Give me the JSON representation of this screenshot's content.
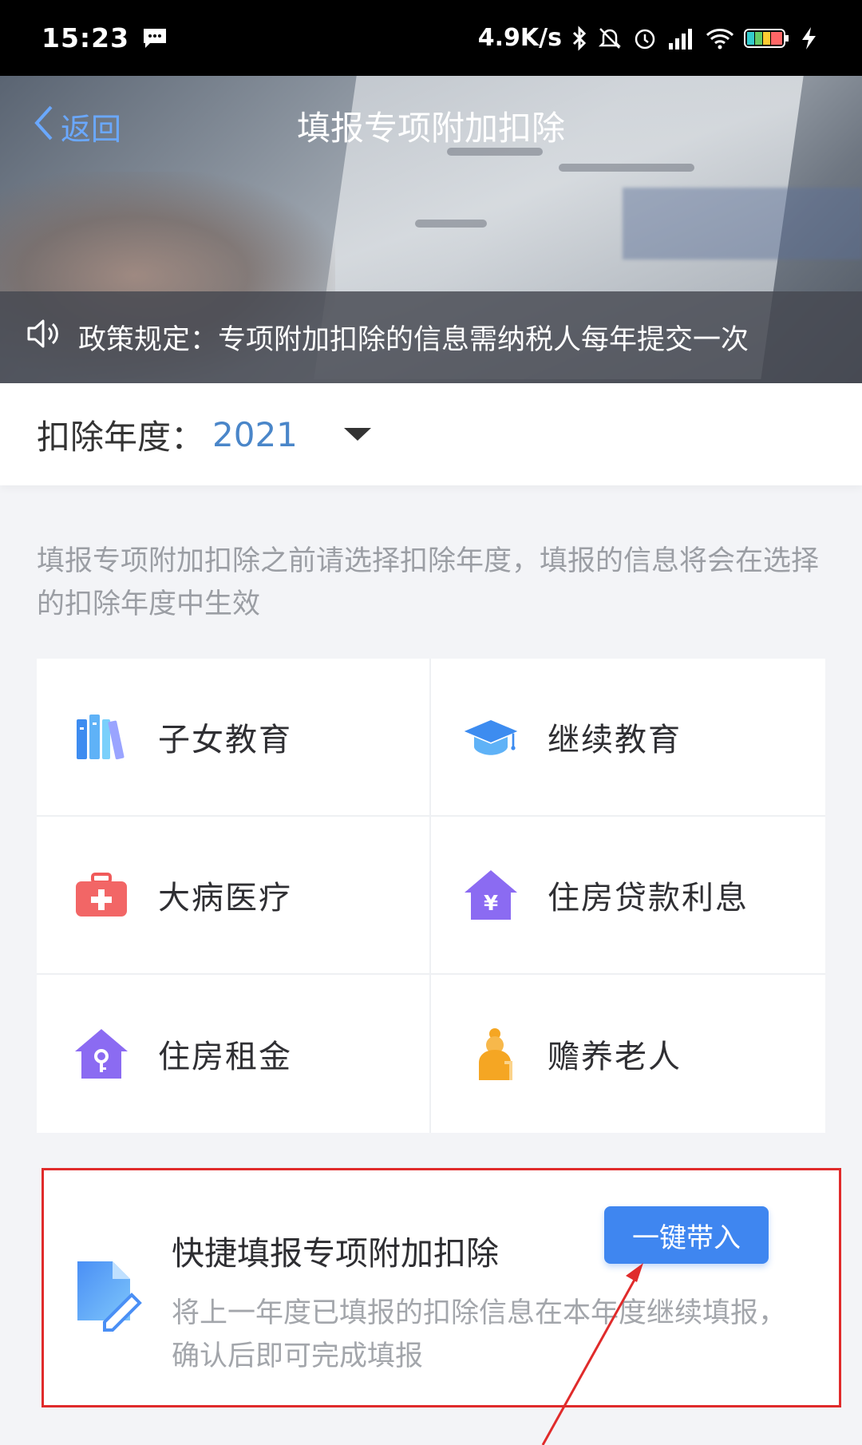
{
  "status_bar": {
    "time": "15:23",
    "net_speed": "4.9K/s",
    "icons": [
      "message-icon",
      "bluetooth-icon",
      "mute-icon",
      "alarm-icon",
      "signal-icon",
      "wifi-icon",
      "battery-icon",
      "charging-icon"
    ]
  },
  "nav": {
    "back_label": "返回",
    "title": "填报专项附加扣除"
  },
  "notice": {
    "text": "政策规定：专项附加扣除的信息需纳税人每年提交一次"
  },
  "year_selector": {
    "label": "扣除年度：",
    "value": "2021"
  },
  "hint": "填报专项附加扣除之前请选择扣除年度，填报的信息将会在选择的扣除年度中生效",
  "categories": [
    {
      "label": "子女教育",
      "icon": "books-icon"
    },
    {
      "label": "继续教育",
      "icon": "graduation-cap-icon"
    },
    {
      "label": "大病医疗",
      "icon": "medical-kit-icon"
    },
    {
      "label": "住房贷款利息",
      "icon": "house-yuan-icon"
    },
    {
      "label": "住房租金",
      "icon": "house-key-icon"
    },
    {
      "label": "赡养老人",
      "icon": "elderly-icon"
    }
  ],
  "quick_fill": {
    "title": "快捷填报专项附加扣除",
    "description": "将上一年度已填报的扣除信息在本年度继续填报，确认后即可完成填报",
    "button_label": "一键带入"
  },
  "colors": {
    "accent": "#3f86f0",
    "link": "#6aa8ff",
    "year_value": "#4a86c9",
    "highlight_border": "#e02b2b"
  }
}
